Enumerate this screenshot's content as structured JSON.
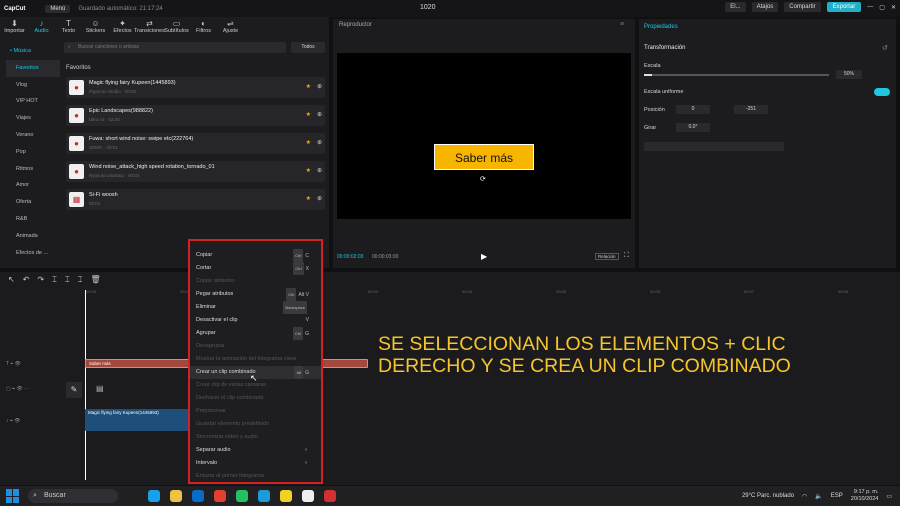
{
  "app": {
    "logo": "CapCut",
    "menu": "Menú",
    "autosave": "Guardado automático: 21:17:24",
    "project_title": "1020",
    "user": "El...",
    "shortcuts": "Atajos",
    "share": "Compartir",
    "export": "Exportar"
  },
  "toolbar": [
    {
      "label": "Importar",
      "icon": "⬇"
    },
    {
      "label": "Audio",
      "icon": "♪"
    },
    {
      "label": "Texto",
      "icon": "T"
    },
    {
      "label": "Stickers",
      "icon": "☺"
    },
    {
      "label": "Efectos",
      "icon": "✦"
    },
    {
      "label": "Transiciones",
      "icon": "⇄"
    },
    {
      "label": "Subtítulos",
      "icon": "▭"
    },
    {
      "label": "Filtros",
      "icon": "◐"
    },
    {
      "label": "Ajuste",
      "icon": "⇌"
    }
  ],
  "sidebar": [
    "• Música",
    "Favoritos",
    "Vlog",
    "VIP HOT",
    "Viajes",
    "Verano",
    "Pop",
    "Ritmos",
    "Amor",
    "Oferta",
    "R&B",
    "Animada",
    "Efectos de ..."
  ],
  "library": {
    "search_placeholder": "Buscar canciones o artistas",
    "filter": "Todos",
    "section": "Favoritos",
    "tracks": [
      {
        "title": "Magic flying fairy Kupeen(1445893)",
        "sub": "Pigmoon Studio · 00:02"
      },
      {
        "title": "Epic Landscapes(988822)",
        "sub": "Ultra v2 · 02:25"
      },
      {
        "title": "Fuwa: short wind noise: swipe etc(222764)",
        "sub": "SRMG · 00:01"
      },
      {
        "title": "Wind noise_attack_high speed rotation_tornado_01",
        "sub": "Ryuyuki Utsukata · 00:03"
      },
      {
        "title": "Si-Fi woosh",
        "sub": "00:01"
      }
    ]
  },
  "player": {
    "title": "Reproductor",
    "overlay_text": "Saber más",
    "time_current": "00:00:02:03",
    "time_total": "00:00:03:00",
    "ratio": "Relación"
  },
  "properties": {
    "title": "Propiedades",
    "transform": "Transformación",
    "scale_label": "Escala",
    "scale_value": "50%",
    "scale_fraction": 0.5,
    "uniform_label": "Escala uniforme",
    "position_label": "Posición",
    "pos_x": "0",
    "pos_y": "-251",
    "rotate_label": "Girar",
    "rotate_value": "0.0°"
  },
  "timeline": {
    "ruler": [
      "00:00",
      "00:01",
      "00:02",
      "00:03",
      "00:04",
      "00:05",
      "00:06",
      "00:07",
      "00:08"
    ],
    "text_clip": "Saber más",
    "audio_clip": "Magic flying fairy Kupeen(1445893)"
  },
  "context_menu": [
    {
      "label": "Copiar",
      "k1": "Ctrl",
      "k2": "C",
      "disabled": false
    },
    {
      "label": "Cortar",
      "k1": "Ctrl",
      "k2": "X",
      "disabled": false
    },
    {
      "label": "Copiar atributos",
      "k1": "",
      "k2": "",
      "disabled": true
    },
    {
      "label": "Pegar atributos",
      "k1": "Ctrl",
      "k2": "Alt V",
      "disabled": false
    },
    {
      "label": "Eliminar",
      "k1": "Backspace",
      "k2": "",
      "disabled": false
    },
    {
      "label": "Desactivar el clip",
      "k1": "",
      "k2": "V",
      "disabled": false
    },
    {
      "label": "Agrupar",
      "k1": "Ctrl",
      "k2": "G",
      "disabled": false
    },
    {
      "label": "Desagrupar",
      "k1": "",
      "k2": "",
      "disabled": true
    },
    {
      "label": "Mostrar la animación del fotograma clave",
      "k1": "",
      "k2": "",
      "disabled": true
    },
    {
      "label": "Crear un clip combinado",
      "k1": "Alt",
      "k2": "G",
      "disabled": false,
      "hover": true
    },
    {
      "label": "Crear clip de varias cámaras",
      "k1": "",
      "k2": "",
      "disabled": true
    },
    {
      "label": "Deshacer el clip combinado",
      "k1": "",
      "k2": "",
      "disabled": true
    },
    {
      "label": "Preprocesar",
      "k1": "",
      "k2": "",
      "disabled": true
    },
    {
      "label": "Guardar elemento predefinido",
      "k1": "",
      "k2": "",
      "disabled": true
    },
    {
      "label": "Sincronizar vídeo y audio",
      "k1": "",
      "k2": "",
      "disabled": true
    },
    {
      "label": "Separar audio",
      "k1": "",
      "k2": "",
      "disabled": false,
      "submenu": true
    },
    {
      "label": "Intervalo",
      "k1": "",
      "k2": "",
      "disabled": false,
      "submenu": true
    },
    {
      "label": "Enlazar al primer fotograma",
      "k1": "",
      "k2": "",
      "disabled": true
    }
  ],
  "caption": "SE SELECCIONAN LOS ELEMENTOS + CLIC DERECHO Y SE CREA UN CLIP COMBINADO",
  "taskbar": {
    "search": "Buscar",
    "weather": "29°C  Parc. nublado",
    "lang": "ESP",
    "time": "9:17 p. m.",
    "date": "20/10/2024"
  }
}
